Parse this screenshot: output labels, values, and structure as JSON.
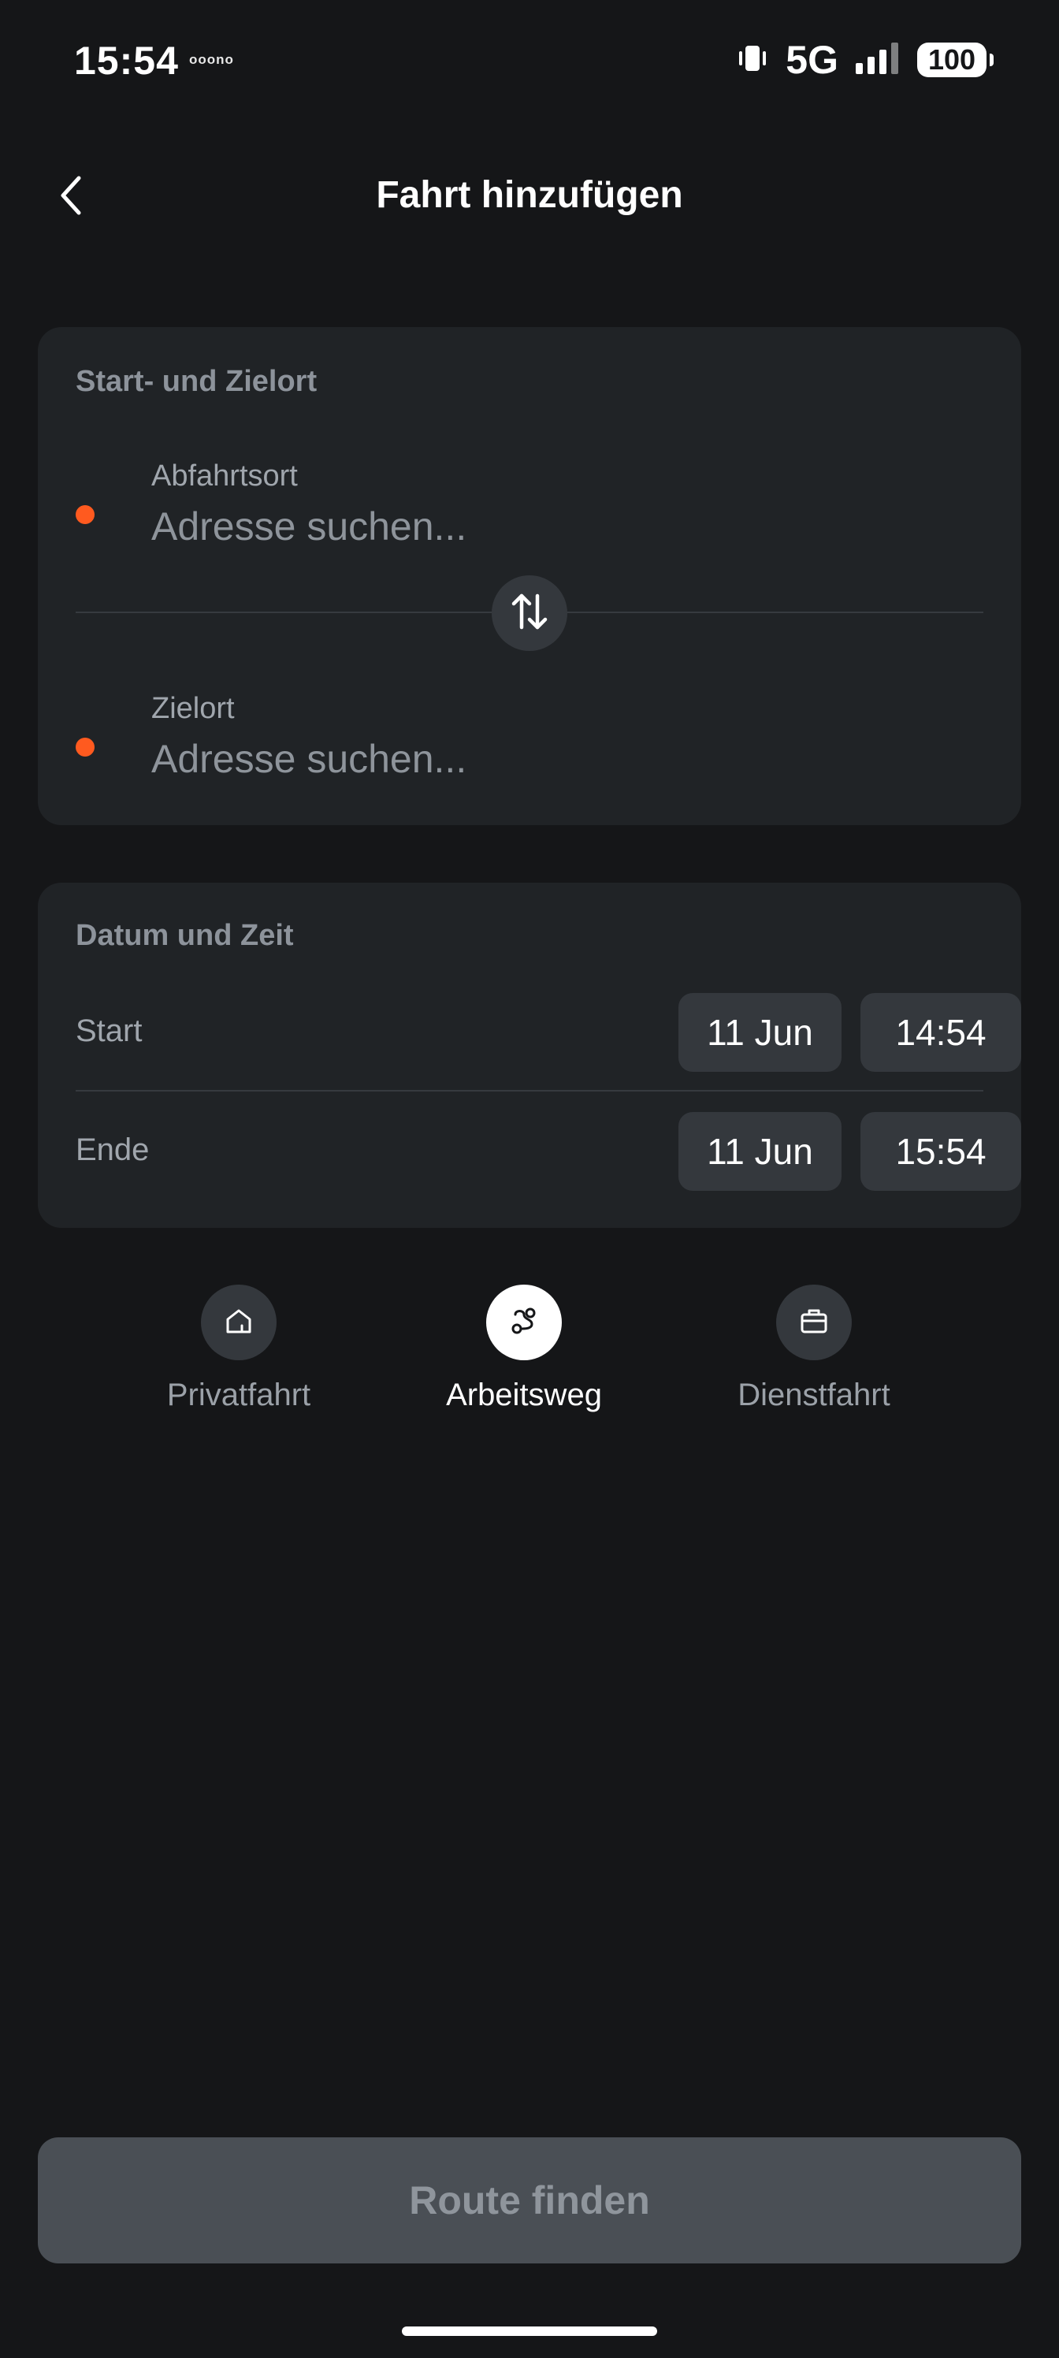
{
  "status_bar": {
    "time": "15:54",
    "carrier": "ooono",
    "network": "5G",
    "battery": "100"
  },
  "header": {
    "title": "Fahrt hinzufügen"
  },
  "locations": {
    "title": "Start- und Zielort",
    "from": {
      "label": "Abfahrtsort",
      "placeholder": "Adresse suchen..."
    },
    "to": {
      "label": "Zielort",
      "placeholder": "Adresse suchen..."
    }
  },
  "datetime": {
    "title": "Datum und Zeit",
    "start": {
      "label": "Start",
      "date": "11 Jun",
      "time": "14:54"
    },
    "end": {
      "label": "Ende",
      "date": "11 Jun",
      "time": "15:54"
    }
  },
  "trip_types": {
    "items": [
      {
        "label": "Privatfahrt",
        "icon": "home-icon"
      },
      {
        "label": "Arbeitsweg",
        "icon": "route-icon"
      },
      {
        "label": "Dienstfahrt",
        "icon": "briefcase-icon"
      }
    ],
    "selected": "Arbeitsweg"
  },
  "actions": {
    "route_button": "Route finden"
  },
  "colors": {
    "background": "#151618",
    "card": "#202326",
    "chip": "#34383d",
    "accent_dot": "#ff5a1f",
    "button_disabled": "#4a4f55"
  }
}
